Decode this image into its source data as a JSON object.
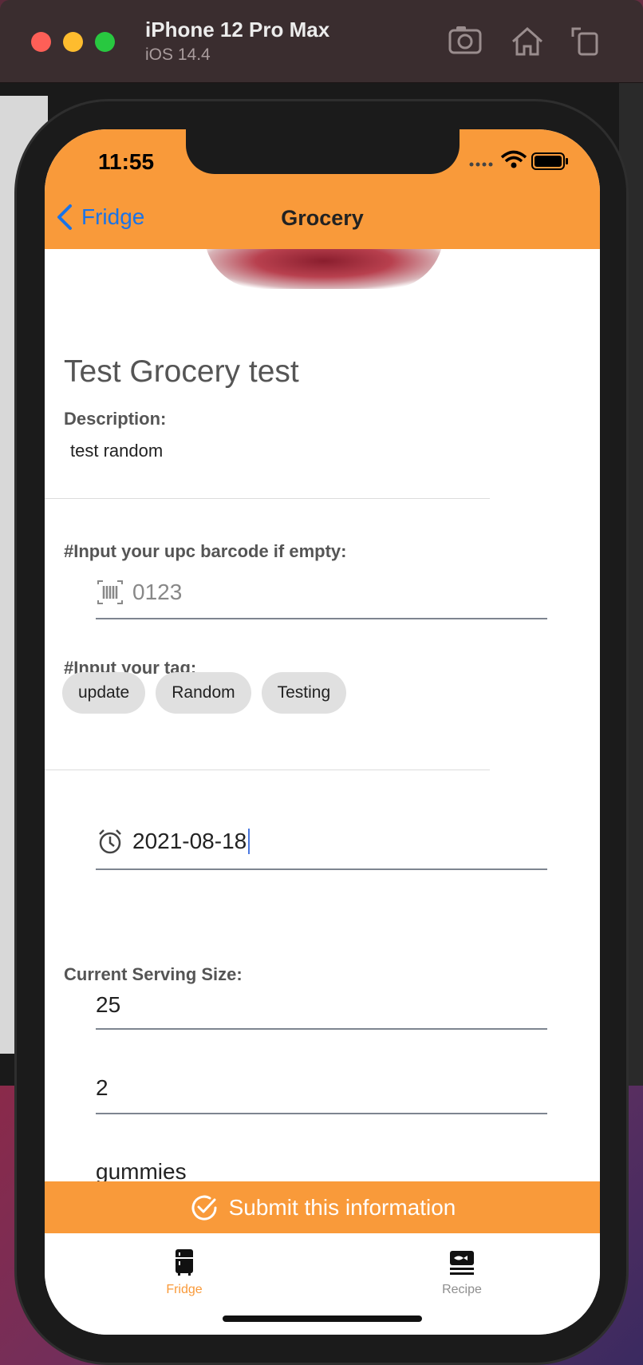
{
  "simulator": {
    "device": "iPhone 12 Pro Max",
    "os": "iOS 14.4"
  },
  "status_bar": {
    "time": "11:55"
  },
  "nav": {
    "back_label": "Fridge",
    "title": "Grocery"
  },
  "grocery": {
    "name": "Test Grocery test",
    "description_label": "Description:",
    "description": "test random"
  },
  "upc": {
    "label": "#Input your upc barcode if empty:",
    "placeholder": "0123"
  },
  "tags": {
    "label": "#Input your tag:",
    "items": [
      "update",
      "Random",
      "Testing"
    ]
  },
  "expiry": {
    "value": "2021-08-18"
  },
  "serving": {
    "label": "Current Serving Size:",
    "size": "25",
    "count": "2",
    "unit": "gummies"
  },
  "submit": {
    "label": "Submit this information"
  },
  "tabbar": {
    "items": [
      {
        "label": "Fridge",
        "icon": "fridge-icon",
        "active": true
      },
      {
        "label": "Recipe",
        "icon": "recipe-icon",
        "active": false
      }
    ]
  },
  "colors": {
    "accent": "#f99a3a",
    "link": "#1a73e8",
    "tab_active": "#f99a3a",
    "tab_inactive": "#8e8e8e"
  }
}
